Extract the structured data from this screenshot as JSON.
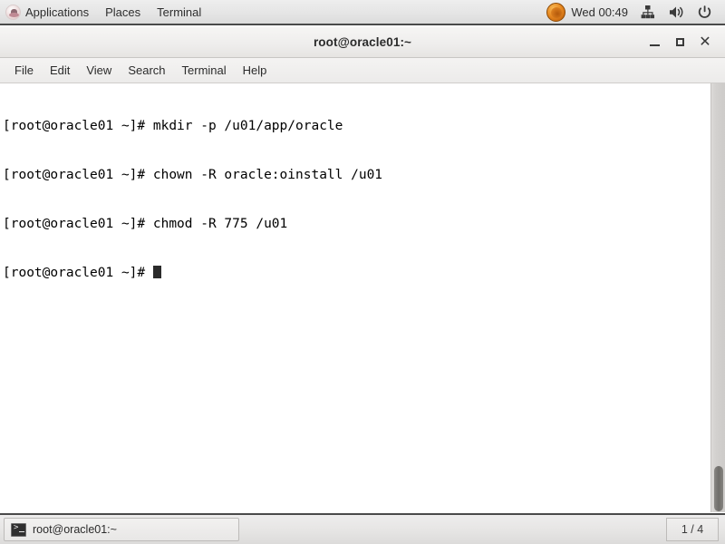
{
  "top_panel": {
    "menus": [
      {
        "label": "Applications",
        "icon": "fedora-logo-icon"
      },
      {
        "label": "Places",
        "icon": null
      },
      {
        "label": "Terminal",
        "icon": null
      }
    ],
    "status": {
      "notification_icon": "orange-circle-badge-icon",
      "clock": "Wed 00:49",
      "network_icon": "network-wired-icon",
      "volume_icon": "volume-speaker-icon",
      "power_icon": "power-button-icon"
    }
  },
  "window": {
    "title": "root@oracle01:~",
    "buttons": {
      "minimize": "minimize-icon",
      "maximize": "maximize-icon",
      "close": "close-icon"
    },
    "menu_bar": [
      "File",
      "Edit",
      "View",
      "Search",
      "Terminal",
      "Help"
    ]
  },
  "terminal": {
    "prompt": "[root@oracle01 ~]#",
    "lines": [
      "[root@oracle01 ~]# mkdir -p /u01/app/oracle",
      "[root@oracle01 ~]# chown -R oracle:oinstall /u01",
      "[root@oracle01 ~]# chmod -R 775 /u01"
    ],
    "current_line": "[root@oracle01 ~]# ",
    "cursor": "block",
    "foreground_color": "#000000",
    "background_color": "#ffffff"
  },
  "bottom_panel": {
    "task": {
      "icon": "terminal-icon",
      "label": "root@oracle01:~"
    },
    "workspace": "1 / 4"
  }
}
